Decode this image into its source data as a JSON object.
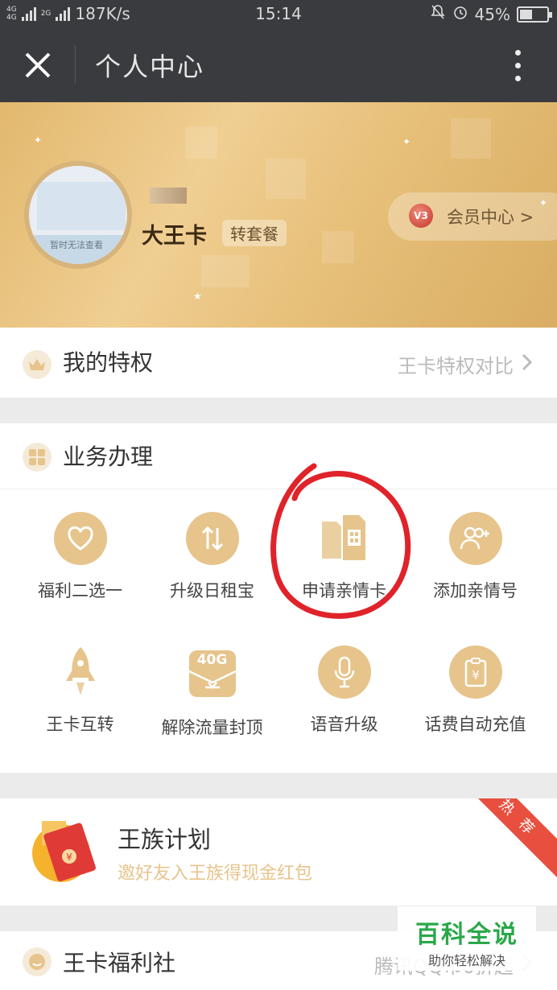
{
  "status_bar": {
    "network_a": "4G",
    "network_b": "4G",
    "network_c": "2G",
    "speed": "187K/s",
    "time": "15:14",
    "battery": "45%"
  },
  "nav": {
    "title": "个人中心"
  },
  "profile": {
    "avatar_caption": "暂时无法查看",
    "name": "大王卡",
    "plan_badge": "转套餐",
    "vip_level": "V3",
    "vip_center": "会员中心 >"
  },
  "privilege": {
    "title": "我的特权",
    "link": "王卡特权对比"
  },
  "services": {
    "title": "业务办理",
    "items": [
      {
        "label": "福利二选一",
        "icon": "heart-icon"
      },
      {
        "label": "升级日租宝",
        "icon": "swap-arrows-icon"
      },
      {
        "label": "申请亲情卡",
        "icon": "sim-cards-icon"
      },
      {
        "label": "添加亲情号",
        "icon": "add-users-icon"
      },
      {
        "label": "王卡互转",
        "icon": "rocket-icon"
      },
      {
        "label": "解除流量封顶",
        "icon": "data-40g-icon",
        "badge": "40G"
      },
      {
        "label": "语音升级",
        "icon": "microphone-icon"
      },
      {
        "label": "话费自动充值",
        "icon": "recharge-icon"
      }
    ]
  },
  "wangzu": {
    "title": "王族计划",
    "subtitle": "邀好友入王族得现金红包",
    "ribbon": "热荐"
  },
  "fuli": {
    "title": "王卡福利社",
    "link": "腾讯QQ币0折起"
  },
  "watermark": {
    "big": "百科全说",
    "small": "助你轻松解决"
  },
  "colors": {
    "gold": "#e6c48b",
    "dark_bar": "#3a3b3f",
    "accent_red": "#e84f3e"
  }
}
